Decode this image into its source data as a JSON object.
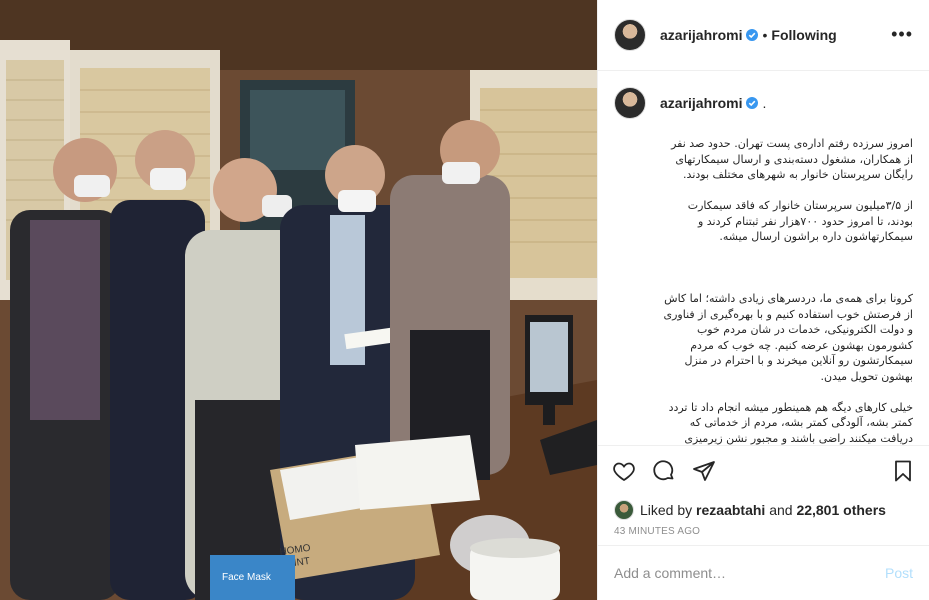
{
  "photo": {
    "alt_icon": "office-photo",
    "box_label_1": "HOMO",
    "box_label_2": "POINT",
    "box_label_3": "Face Mask"
  },
  "header": {
    "username": "azarijahromi",
    "verified_icon": "verified-badge-icon",
    "separator": "•",
    "follow_status": "Following",
    "more_icon": "more-options-icon",
    "more_label": "•••"
  },
  "caption": {
    "username": "azarijahromi",
    "suffix": ".",
    "paragraphs": [
      "امروز سرزده رفتم اداره‌ی پست تهران. حدود صد نفر از همکاران، مشغول دسته‌بندی و ارسال سیمکارتهای رایگان سرپرستان خانوار به شهرهای مختلف بودند.",
      "از ۳/۵میلیون سرپرستان خانوار که فاقد سیمکارت بودند، تا امروز حدود ۷۰۰هزار نفر ثبتنام کردند و سیمکارتهاشون داره براشون ارسال میشه.",
      "",
      "کرونا برای همه‌ی ما، دردسرهای زیادی داشته؛ اما کاش از فرصتش خوب استفاده کنیم و با بهره‌گیری از فناوری و دولت الکترونیکی، خدمات در شان مردم خوب کشورمون بهشون عرضه کنیم. چه خوب که مردم سیمکارتشون رو آنلاین میخرند و با احترام در منزل بهشون تحویل میدن.",
      "خیلی کارهای دیگه هم همینطور میشه انجام داد تا تردد کمتر بشه، آلودگی کمتر بشه، مردم از خدماتی که دریافت میکنند راضی باشند و مجبور نشن زیرمیزی بدند."
    ]
  },
  "actions": {
    "like_icon": "heart-icon",
    "comment_icon": "comment-icon",
    "share_icon": "share-icon",
    "save_icon": "bookmark-icon"
  },
  "likes": {
    "prefix": "Liked by",
    "first_user": "rezaabtahi",
    "conjunction": "and",
    "others": "22,801 others"
  },
  "time_ago": "43 MINUTES AGO",
  "comment_box": {
    "placeholder": "Add a comment…",
    "post_label": "Post"
  },
  "colors": {
    "verified_blue": "#3897f0",
    "post_disabled": "#b2dffc",
    "border": "#efefef",
    "muted": "#8e8e8e"
  }
}
